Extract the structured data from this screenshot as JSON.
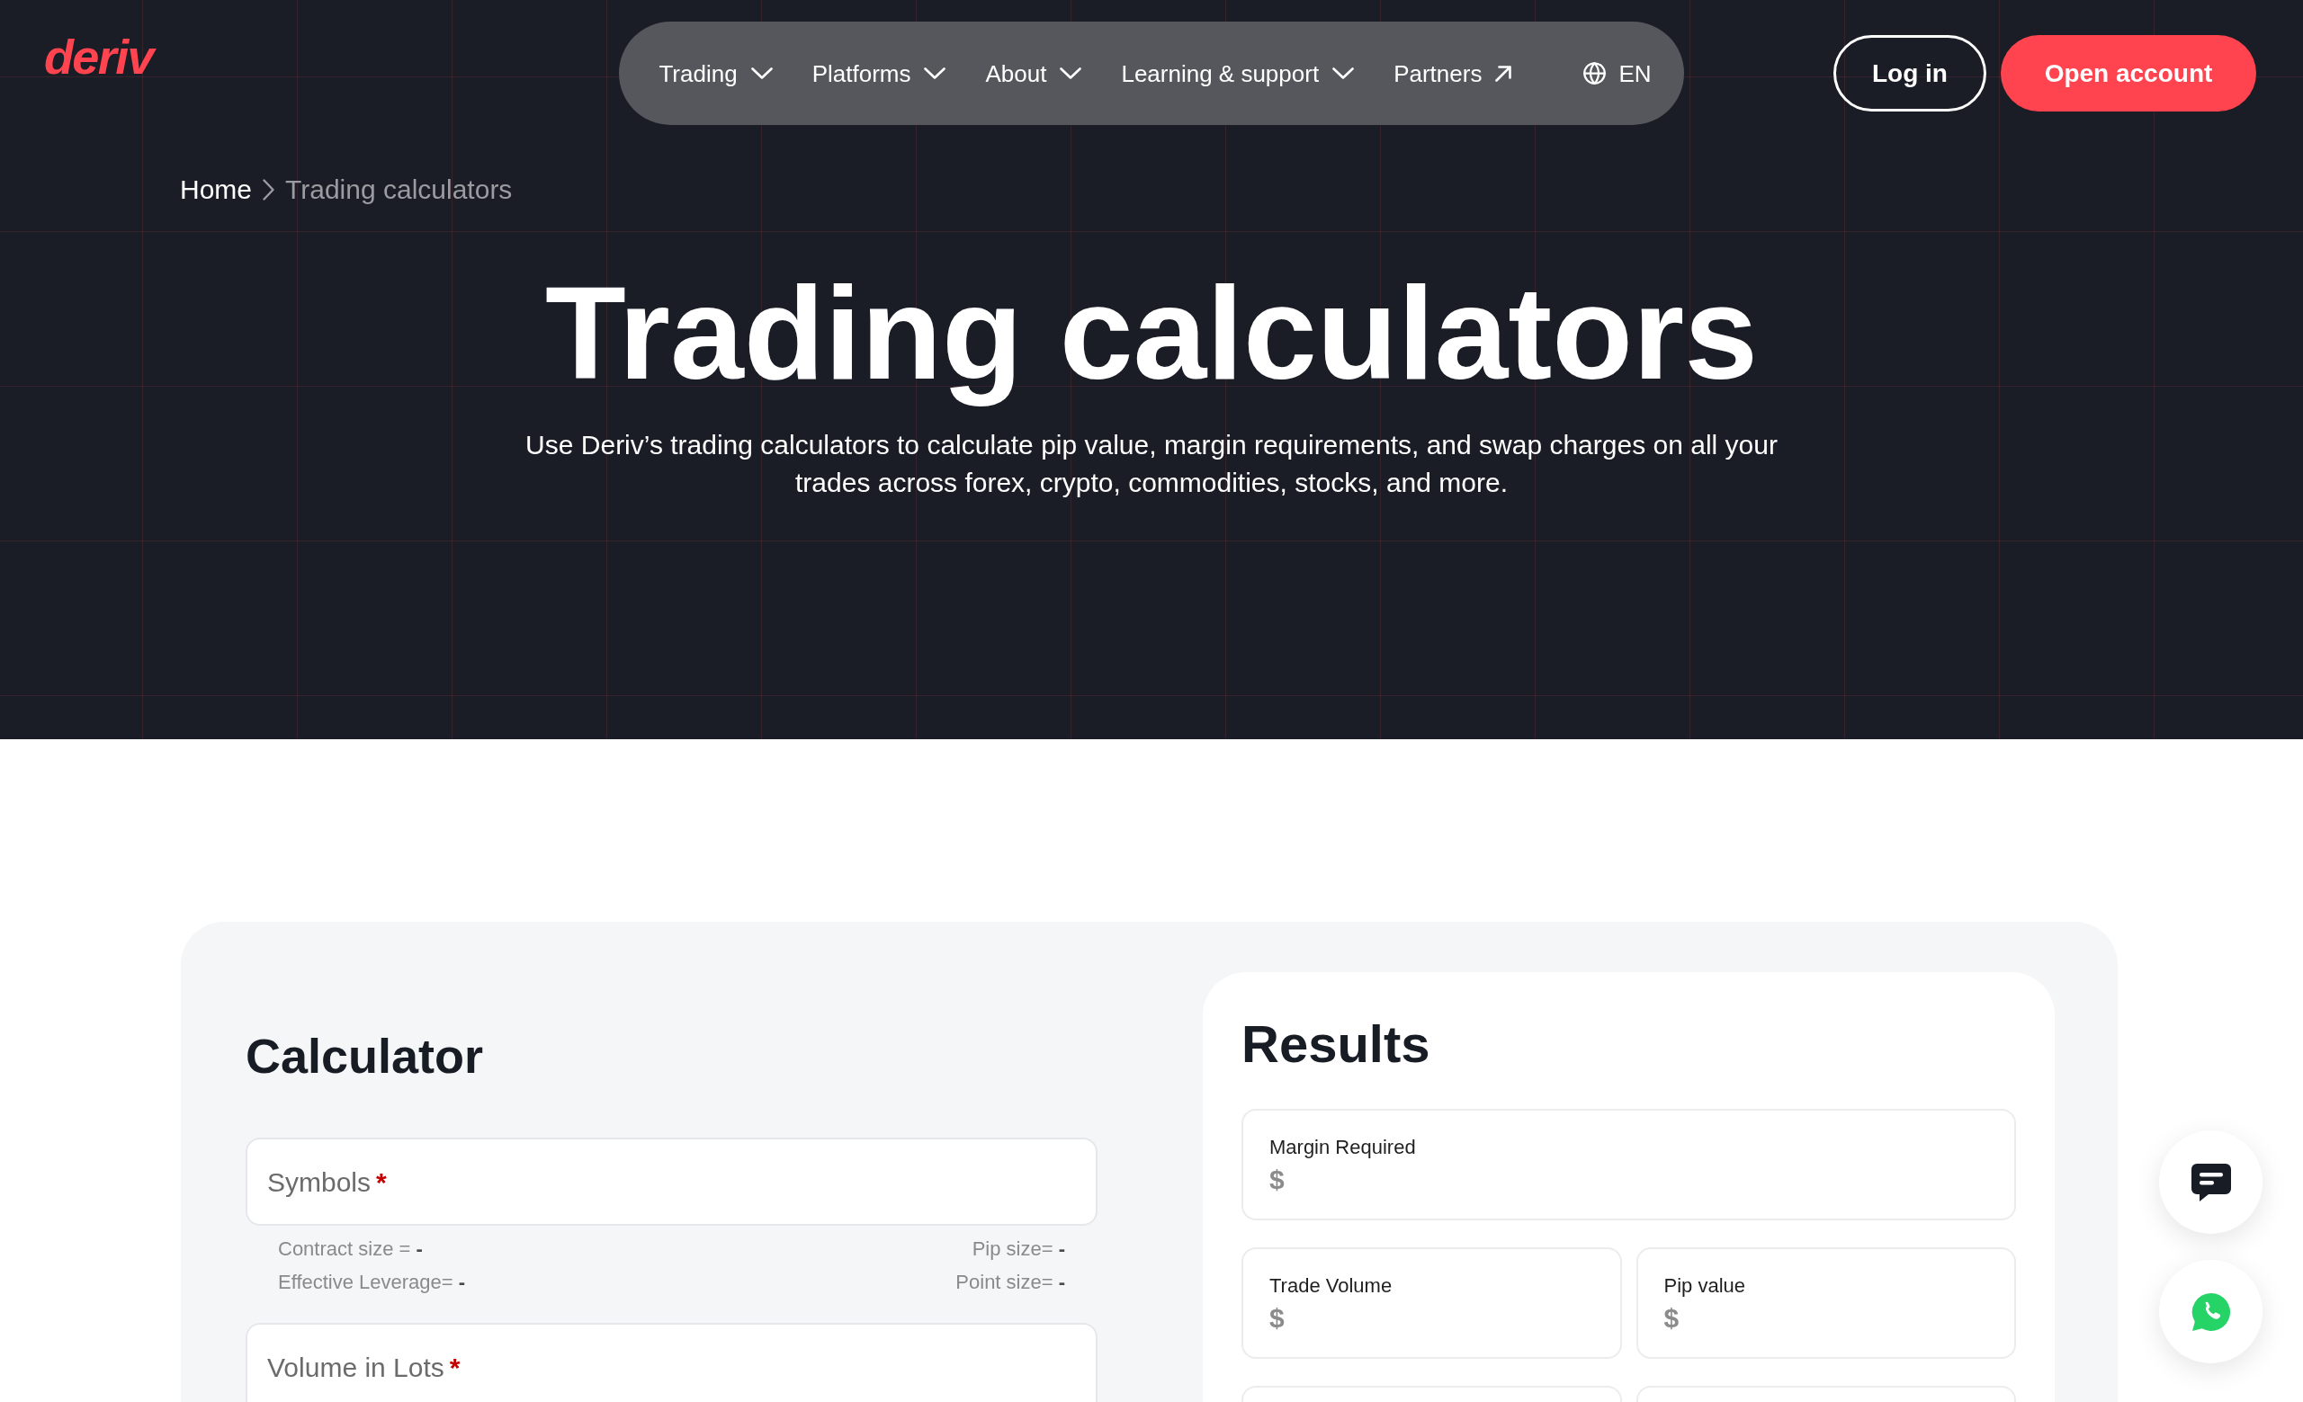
{
  "header": {
    "logo": "deriv",
    "nav": [
      {
        "label": "Trading",
        "kind": "menu"
      },
      {
        "label": "Platforms",
        "kind": "menu"
      },
      {
        "label": "About",
        "kind": "menu"
      },
      {
        "label": "Learning & support",
        "kind": "menu"
      },
      {
        "label": "Partners",
        "kind": "external"
      }
    ],
    "language": "EN",
    "buttons": [
      {
        "label": "Log in",
        "kind": "outline"
      },
      {
        "label": "Open account",
        "kind": "primary"
      }
    ]
  },
  "breadcrumb": [
    {
      "label": "Home",
      "current": false
    },
    {
      "label": "Trading calculators",
      "current": true
    }
  ],
  "hero": {
    "title": "Trading calculators",
    "subtitle": "Use Deriv’s trading calculators to calculate pip value, margin requirements, and swap charges on all your trades across forex, crypto, commodities, stocks, and more."
  },
  "calculator": {
    "title": "Calculator",
    "fields": [
      {
        "label": "Symbols",
        "marker": "*",
        "specs": [
          "Contract size = **-**",
          "Pip size= **-**",
          "Effective Leverage= **-**",
          "Point size= **-**"
        ]
      },
      {
        "label": "Volume in Lots",
        "marker": "*"
      }
    ]
  },
  "results": {
    "title": "Results",
    "cards": [
      {
        "label": "Margin Required",
        "value": "$",
        "kind": "wide"
      },
      {
        "label": "Trade Volume",
        "value": "$",
        "kind": "half"
      },
      {
        "label": "Pip value",
        "value": "$",
        "kind": "half"
      }
    ]
  }
}
